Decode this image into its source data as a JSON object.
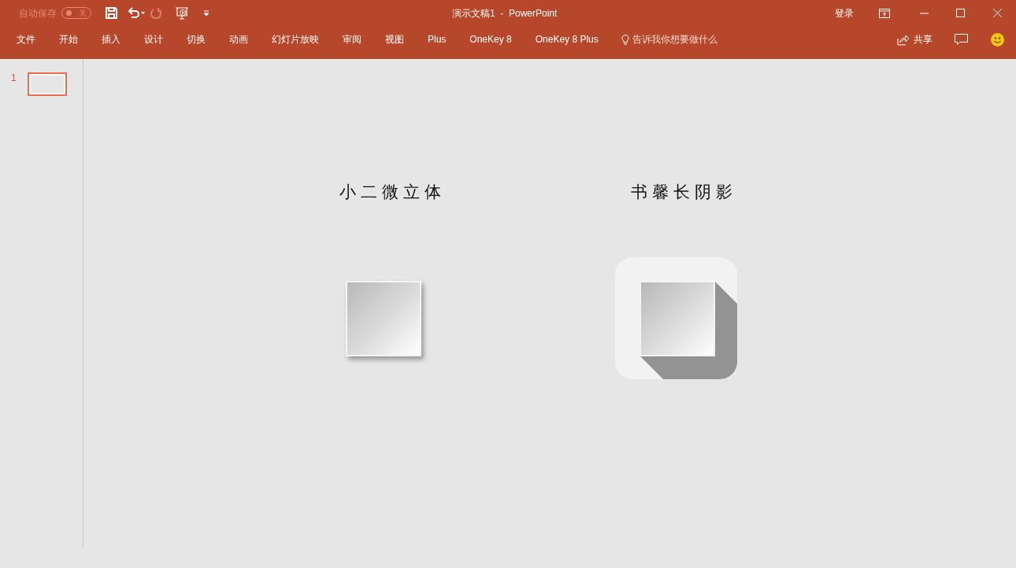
{
  "window": {
    "title": "演示文稿1  -  PowerPoint"
  },
  "quick_access": {
    "autosave_label": "自动保存",
    "autosave_toggle": {
      "text": "关",
      "on": false
    }
  },
  "account": {
    "sign_in": "登录"
  },
  "ribbon_tabs": [
    {
      "label": "文件"
    },
    {
      "label": "开始"
    },
    {
      "label": "插入"
    },
    {
      "label": "设计"
    },
    {
      "label": "切换"
    },
    {
      "label": "动画"
    },
    {
      "label": "幻灯片放映"
    },
    {
      "label": "审阅"
    },
    {
      "label": "视图"
    },
    {
      "label": "Plus"
    },
    {
      "label": "OneKey 8"
    },
    {
      "label": "OneKey 8 Plus"
    }
  ],
  "tell_me": {
    "placeholder": "告诉我你想要做什么"
  },
  "share": {
    "label": "共享"
  },
  "slides": [
    {
      "number": "1",
      "selected": true
    }
  ],
  "slide": {
    "examples": [
      {
        "kind": "micro-3d",
        "title": "小二微立体"
      },
      {
        "kind": "long-shadow",
        "title": "书馨长阴影"
      }
    ]
  }
}
